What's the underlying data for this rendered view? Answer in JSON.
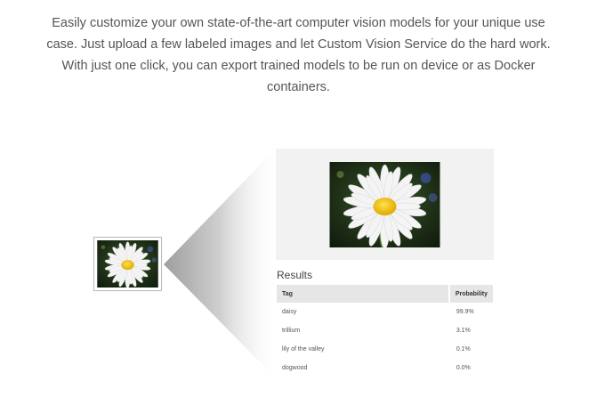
{
  "intro": {
    "text": "Easily customize your own state-of-the-art computer vision models for your unique use case. Just upload a few labeled images and let Custom Vision Service do the hard work. With just one click, you can export trained models to be run on device or as Docker containers."
  },
  "results": {
    "title": "Results",
    "columns": [
      "Tag",
      "Probability"
    ],
    "rows": [
      {
        "tag": "daisy",
        "probability": "99.9%"
      },
      {
        "tag": "trillium",
        "probability": "3.1%"
      },
      {
        "tag": "lily of the valley",
        "probability": "0.1%"
      },
      {
        "tag": "dogwood",
        "probability": "0.0%"
      }
    ]
  },
  "colors": {
    "panel_bg": "#f2f2f2",
    "table_header_bg": "#e6e6e6",
    "petal": "#f4f4f4",
    "flower_center": "#f2c200",
    "photo_background": "#1e3016"
  }
}
